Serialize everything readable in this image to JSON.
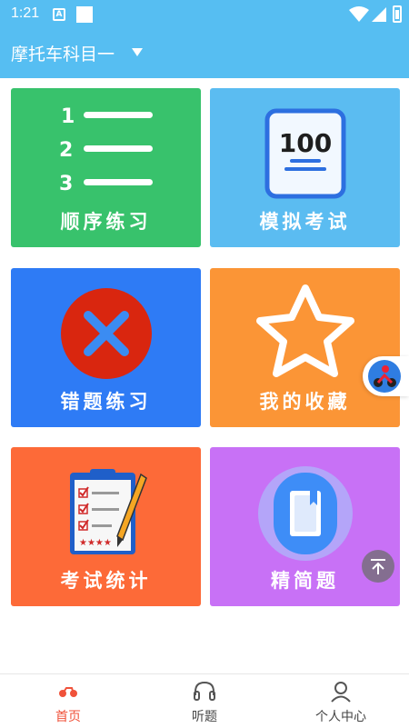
{
  "status_bar": {
    "time": "1:21",
    "app_icon_letter": "A"
  },
  "app_bar": {
    "title": "摩托车科目一"
  },
  "tiles": [
    {
      "label": "顺序练习",
      "color": "#38c26c",
      "icon": "numbered-list-icon"
    },
    {
      "label": "模拟考试",
      "color": "#5bbcf1",
      "icon": "score-100-icon",
      "icon_text": "100"
    },
    {
      "label": "错题练习",
      "color": "#2e7bf5",
      "icon": "wrong-x-icon"
    },
    {
      "label": "我的收藏",
      "color": "#fb9536",
      "icon": "star-icon"
    },
    {
      "label": "考试统计",
      "color": "#fd6a38",
      "icon": "clipboard-checklist-icon"
    },
    {
      "label": "精简题",
      "color": "#c871f6",
      "icon": "book-icon"
    }
  ],
  "bottom_nav": [
    {
      "label": "首页",
      "icon": "motorcycle-icon",
      "active": true
    },
    {
      "label": "听题",
      "icon": "headphones-icon",
      "active": false
    },
    {
      "label": "个人中心",
      "icon": "person-icon",
      "active": false
    }
  ],
  "colors": {
    "app_bar": "#56bef2",
    "active_nav": "#f0523a"
  }
}
